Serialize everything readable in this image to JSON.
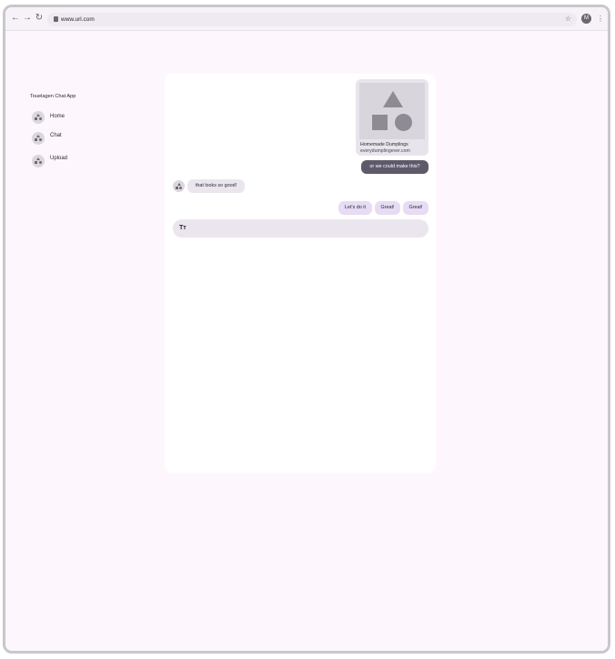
{
  "browser": {
    "url": "www.url.com",
    "profile_initial": "M",
    "icons": {
      "back": "arrow-left-icon",
      "forward": "arrow-right-icon",
      "reload": "reload-icon",
      "lock": "lock-icon",
      "bookmark": "star-icon",
      "menu": "more-vert-icon"
    }
  },
  "sidebar": {
    "title": "Touelagen Chat App",
    "items": [
      {
        "label": "Home"
      },
      {
        "label": "Chat"
      },
      {
        "label": "Upload"
      }
    ]
  },
  "chat": {
    "link_card": {
      "title": "Homemade Dumplings",
      "domain": "everydumplingever.com"
    },
    "outgoing_message": "or we could make this?",
    "incoming_message": "that looks so good!",
    "suggestions": [
      "Let's do it",
      "Great!",
      "Great!"
    ],
    "composer": {
      "icon_text": "Tт",
      "value": "",
      "placeholder": ""
    }
  },
  "colors": {
    "page_bg": "#fdf7fd",
    "outgoing_bubble": "#5f5a6a",
    "suggestion_chip": "#e7dcf4",
    "incoming_bubble": "#ebe6ee"
  }
}
